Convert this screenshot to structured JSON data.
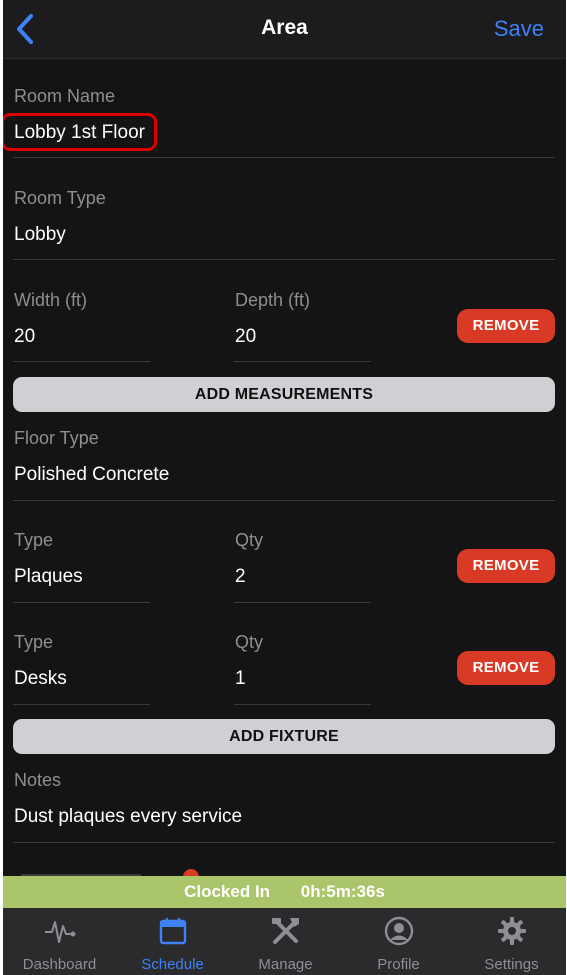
{
  "header": {
    "title": "Area",
    "save_label": "Save"
  },
  "room_name": {
    "label": "Room Name",
    "value": "Lobby 1st Floor"
  },
  "room_type": {
    "label": "Room Type",
    "value": "Lobby"
  },
  "measurement": {
    "width_label": "Width (ft)",
    "width_value": "20",
    "depth_label": "Depth (ft)",
    "depth_value": "20",
    "remove_label": "REMOVE"
  },
  "add_measurements_label": "ADD MEASUREMENTS",
  "floor_type": {
    "label": "Floor Type",
    "value": "Polished Concrete"
  },
  "fixtures": [
    {
      "type_label": "Type",
      "type_value": "Plaques",
      "qty_label": "Qty",
      "qty_value": "2",
      "remove_label": "REMOVE"
    },
    {
      "type_label": "Type",
      "type_value": "Desks",
      "qty_label": "Qty",
      "qty_value": "1",
      "remove_label": "REMOVE"
    }
  ],
  "add_fixture_label": "ADD FIXTURE",
  "notes": {
    "label": "Notes",
    "value": "Dust plaques every service"
  },
  "clock": {
    "status": "Clocked In",
    "elapsed": "0h:5m:36s"
  },
  "tabs": [
    {
      "label": "Dashboard",
      "icon": "pulse-icon"
    },
    {
      "label": "Schedule",
      "icon": "calendar-icon",
      "active": true
    },
    {
      "label": "Manage",
      "icon": "tools-icon"
    },
    {
      "label": "Profile",
      "icon": "user-circle-icon"
    },
    {
      "label": "Settings",
      "icon": "gear-icon"
    }
  ],
  "colors": {
    "accent": "#3d82f6",
    "remove": "#d83a26",
    "clock_bar": "#abc56a",
    "highlight": "#e00000"
  }
}
